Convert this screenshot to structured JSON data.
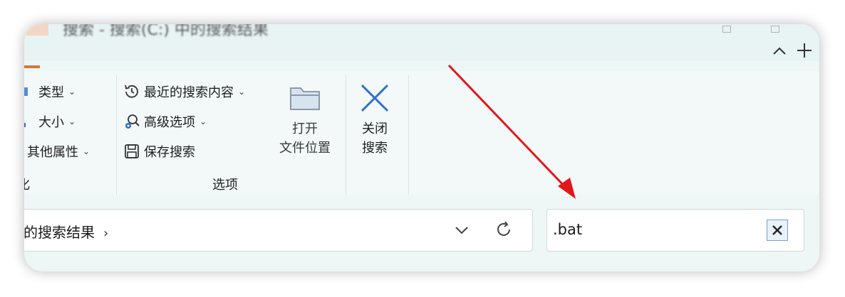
{
  "title_blurred": "搜索 - 搜索(C:) 中的搜索结果",
  "ribbon": {
    "sort_group": {
      "type_label": "类型",
      "size_label": "大小",
      "other_props_label": "其他属性",
      "group_label": "化"
    },
    "options_group": {
      "recent_searches_label": "最近的搜索内容",
      "advanced_options_label": "高级选项",
      "save_search_label": "保存搜索",
      "group_label": "选项"
    },
    "open_location": {
      "line1": "打开",
      "line2": "文件位置"
    },
    "close_search": {
      "line1": "关闭",
      "line2": "搜索"
    }
  },
  "address_bar": {
    "breadcrumb": "的搜索结果",
    "separator": "›"
  },
  "search_box": {
    "value": ".bat"
  },
  "colors": {
    "accent_blue": "#2f6fd1",
    "arrow_red": "#e3161b",
    "ribbon_bg": "#f3f8f8"
  },
  "icons": {
    "collapse": "chevron-up-icon",
    "add": "plus-icon",
    "type": "tag-icon",
    "size": "size-icon",
    "recent": "history-icon",
    "advanced": "search-gear-icon",
    "save": "floppy-icon",
    "folder": "folder-icon",
    "close": "x-icon",
    "dropdown": "chevron-down-icon",
    "refresh": "refresh-icon",
    "clear": "clear-x-icon"
  }
}
